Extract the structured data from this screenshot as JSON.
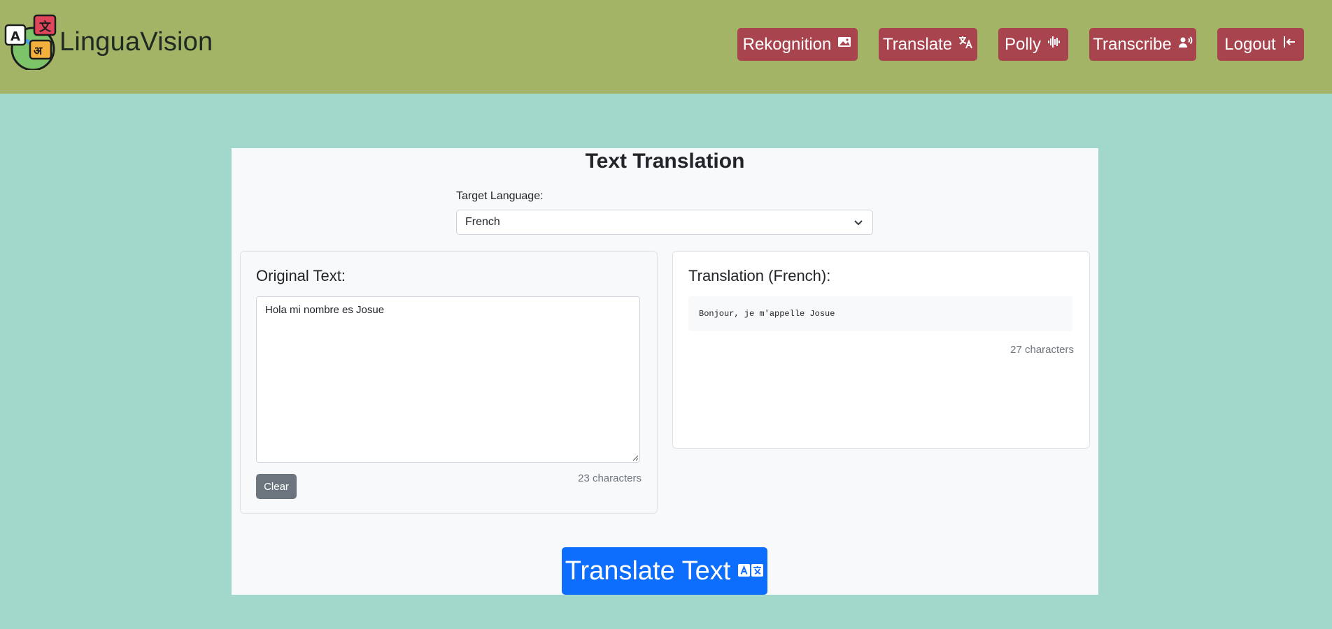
{
  "header": {
    "brand": "LinguaVision",
    "nav": [
      {
        "label": "Rekognition",
        "icon": "image-icon"
      },
      {
        "label": "Translate",
        "icon": "translate-icon"
      },
      {
        "label": "Polly",
        "icon": "soundwave-icon"
      },
      {
        "label": "Transcribe",
        "icon": "person-voice-icon"
      },
      {
        "label": "Logout",
        "icon": "box-arrow-left-icon"
      }
    ]
  },
  "main": {
    "title": "Text Translation",
    "target_language_label": "Target Language:",
    "target_language_value": "French",
    "original": {
      "title": "Original Text:",
      "text": "Hola mi nombre es Josue",
      "clear_label": "Clear",
      "char_count": "23 characters"
    },
    "translation": {
      "title": "Translation (French):",
      "text": "Bonjour, je m'appelle Josue",
      "char_count": "27 characters"
    },
    "translate_button_label": "Translate Text"
  },
  "colors": {
    "header_bg": "#a3b467",
    "page_bg": "#a2d8cb",
    "nav_button": "#a8444d",
    "primary": "#0d6efd",
    "secondary": "#6c757d"
  }
}
